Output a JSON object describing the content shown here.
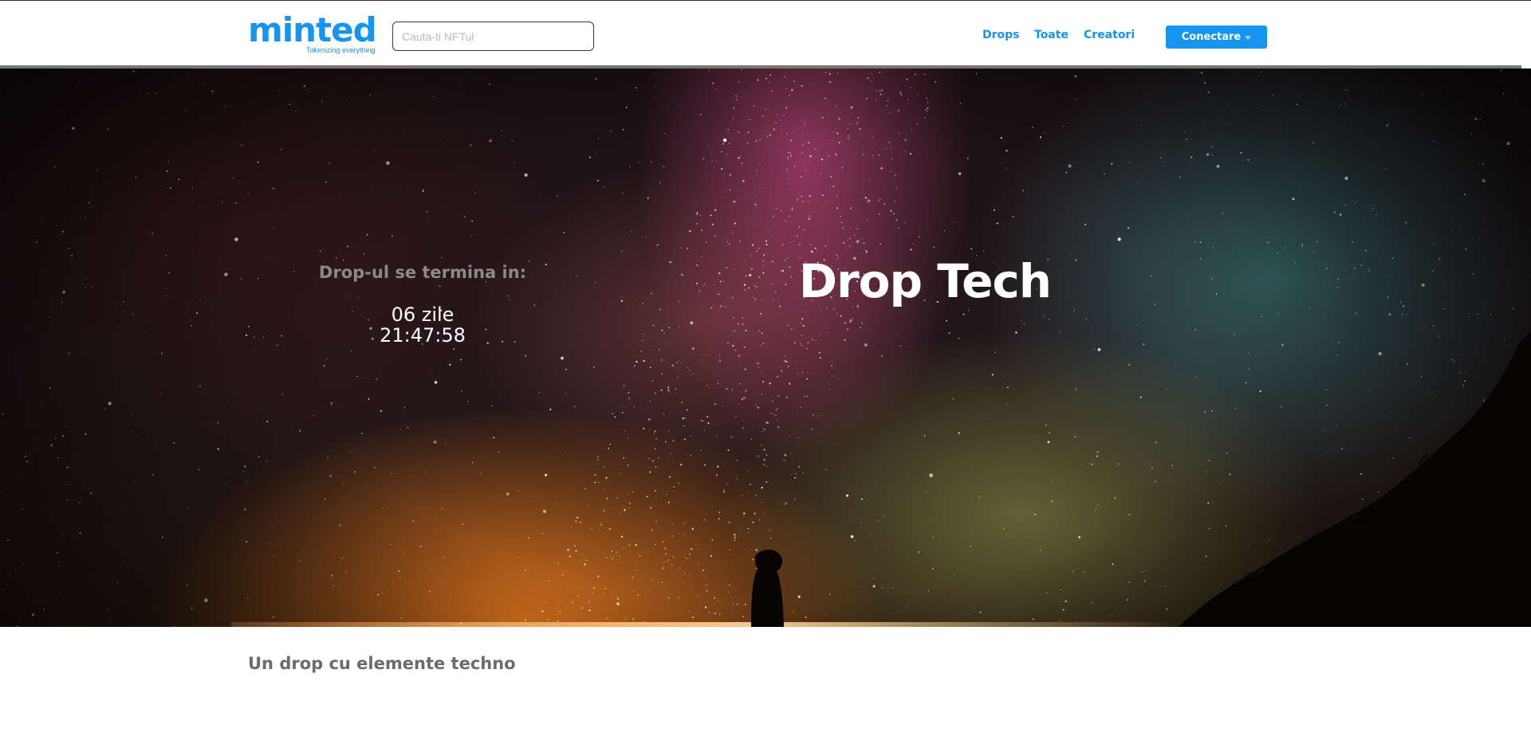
{
  "header": {
    "logo": {
      "name": "minted",
      "tagline": "Tokenizing everything"
    },
    "search": {
      "placeholder": "Cauta-ti NFTul",
      "value": ""
    },
    "nav": {
      "drops": "Drops",
      "toate": "Toate",
      "creatori": "Creatori"
    },
    "connect_button": {
      "label": "Conectare",
      "icon": "caret-down-icon"
    }
  },
  "hero": {
    "countdown_label": "Drop-ul se termina in:",
    "countdown_days": "06 zile",
    "countdown_time": "21:47:58",
    "title": "Drop Tech",
    "background": "night-sky-milky-way-photo"
  },
  "description": "Un drop cu elemente techno",
  "colors": {
    "brand": "#1793f0",
    "header_rule": "#767676",
    "description_text": "#6b6b6b",
    "countdown_label": "#8a8a8a"
  }
}
